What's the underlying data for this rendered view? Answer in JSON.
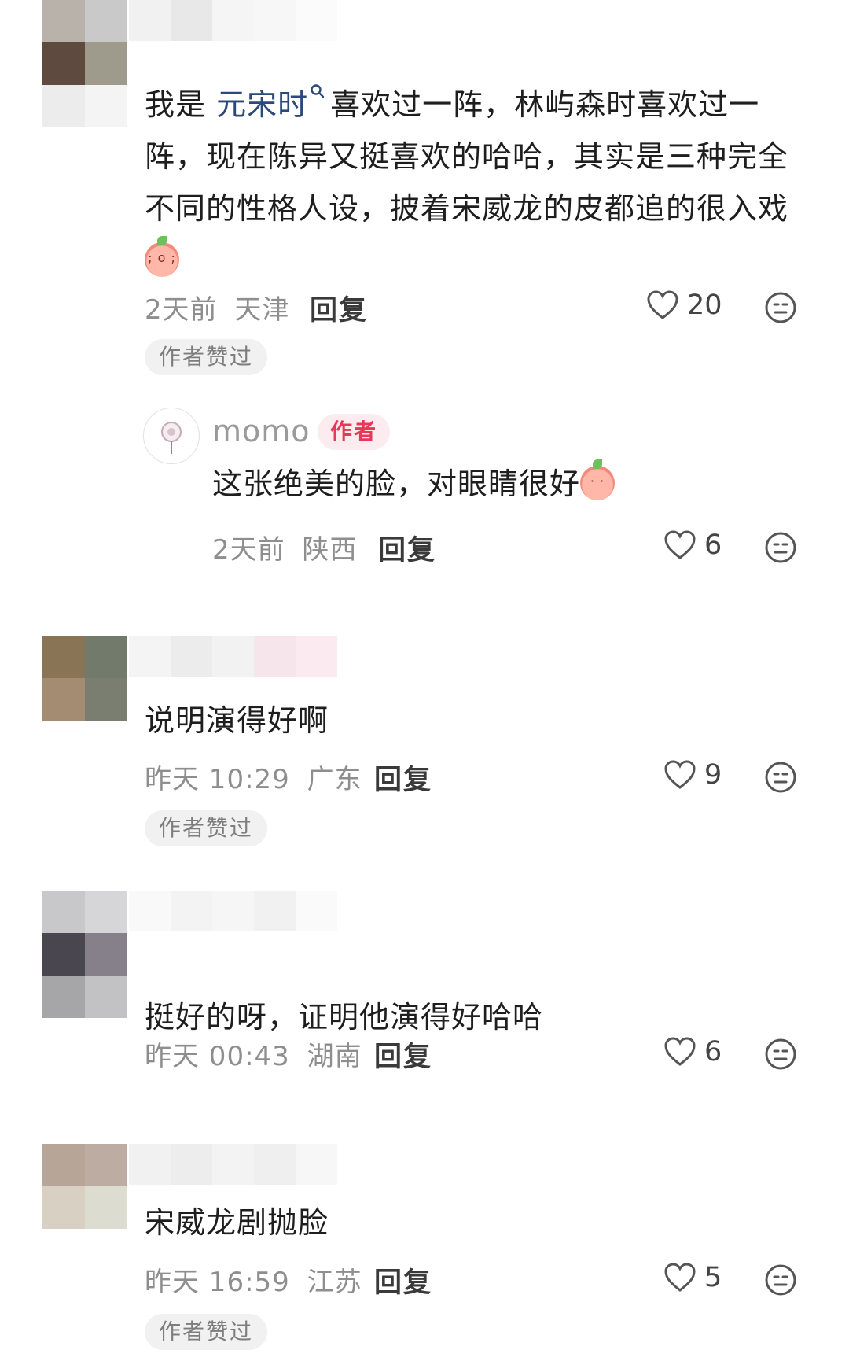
{
  "comments": [
    {
      "text_before_link": "我是",
      "link": "元宋时",
      "text_after_link": "喜欢过一阵，林屿森时喜欢过一阵，现在陈异又挺喜欢的哈哈，其实是三种完全不同的性格人设，披着宋威龙的皮都追的很入戏",
      "time": "2天前",
      "location": "天津",
      "reply_label": "回复",
      "likes": "20",
      "badge": "作者赞过",
      "reply": {
        "username": "momo",
        "author_tag": "作者",
        "text": "这张绝美的脸，对眼睛很好",
        "time": "2天前",
        "location": "陕西",
        "reply_label": "回复",
        "likes": "6"
      }
    },
    {
      "text": "说明演得好啊",
      "time": "昨天 10:29",
      "location": "广东",
      "reply_label": "回复",
      "likes": "9",
      "badge": "作者赞过"
    },
    {
      "text": "挺好的呀，证明他演得好哈哈",
      "time": "昨天 00:43",
      "location": "湖南",
      "reply_label": "回复",
      "likes": "6"
    },
    {
      "text": "宋威龙剧抛脸",
      "time": "昨天 16:59",
      "location": "江苏",
      "reply_label": "回复",
      "likes": "5",
      "badge": "作者赞过"
    }
  ],
  "icons": {
    "like": "heart-outline-icon",
    "dislike": "neutral-face-icon",
    "search_hint": "search-icon"
  },
  "colors": {
    "link": "#2b4a7a",
    "author_tag_text": "#e6395a",
    "author_tag_bg": "#fdecef",
    "meta_text": "#8e8e8e"
  }
}
